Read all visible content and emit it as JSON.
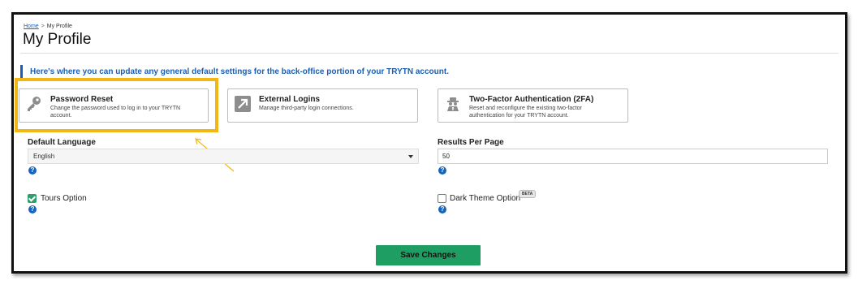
{
  "breadcrumb": {
    "home": "Home",
    "separator": ">",
    "current": "My Profile"
  },
  "page": {
    "title": "My Profile"
  },
  "info": {
    "text": "Here's where you can update any general default settings for the back-office portion of your TRYTN account."
  },
  "cards": [
    {
      "title": "Password Reset",
      "desc": "Change the password used to log in to your TRYTN account.",
      "icon": "key-icon"
    },
    {
      "title": "External Logins",
      "desc": "Manage third-party login connections.",
      "icon": "external-link-icon"
    },
    {
      "title": "Two-Factor Authentication (2FA)",
      "desc": "Reset and reconfigure the existing two-factor authentication for your TRYTN account.",
      "icon": "spy-icon"
    }
  ],
  "settings": {
    "language_label": "Default Language",
    "language_value": "English",
    "results_label": "Results Per Page",
    "results_value": "50",
    "tours_label": "Tours Option",
    "tours_checked": true,
    "dark_label": "Dark Theme Option",
    "dark_checked": false,
    "beta_badge": "BETA",
    "help_glyph": "?"
  },
  "actions": {
    "save_label": "Save Changes"
  },
  "colors": {
    "accent_blue": "#1a5fb4",
    "save_green": "#1e9e62",
    "highlight_yellow": "#f3b713",
    "check_green": "#2e9e6b"
  }
}
